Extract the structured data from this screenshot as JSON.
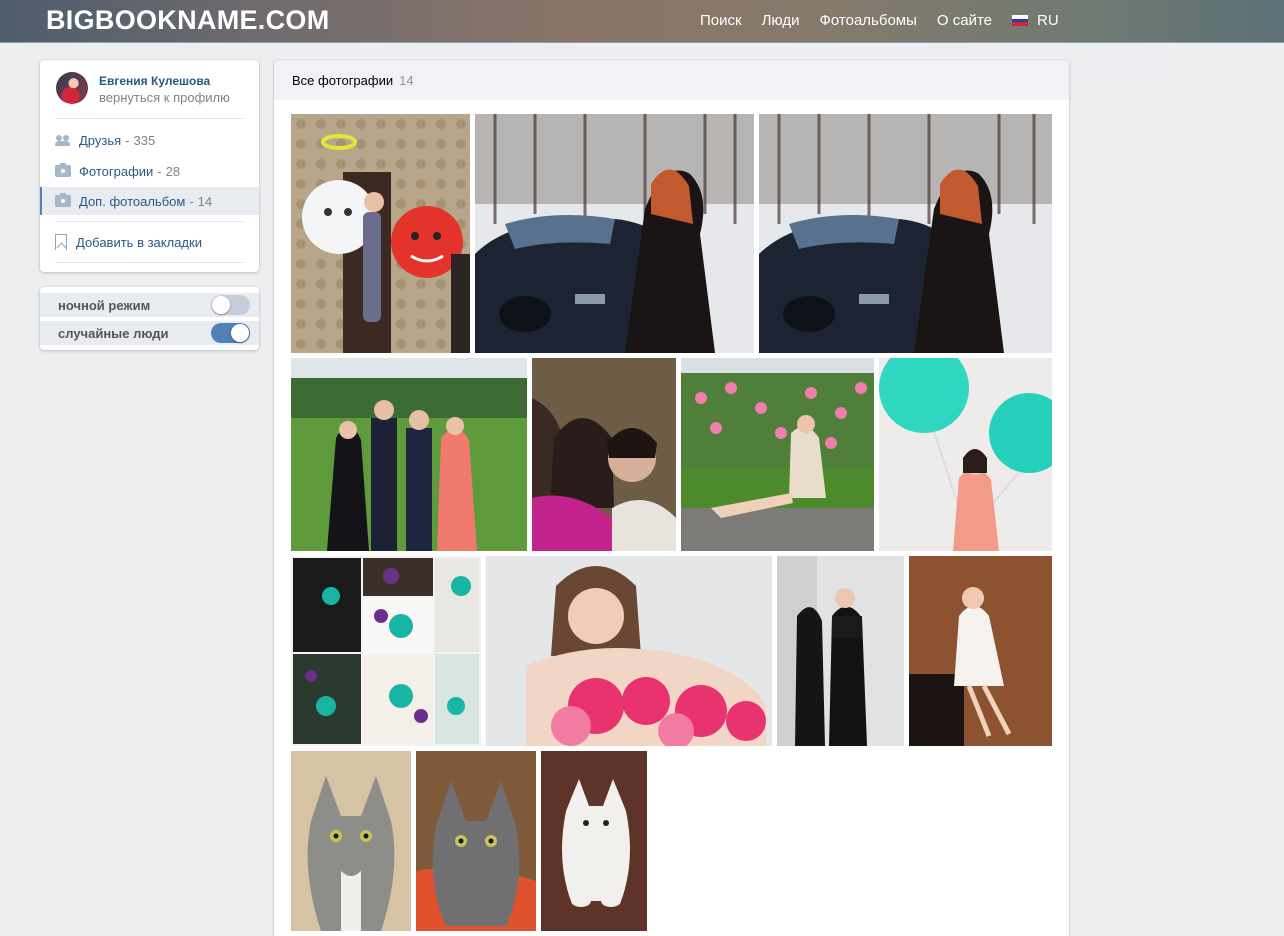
{
  "header": {
    "logo": "BIGBOOKNAME.COM",
    "nav": [
      "Поиск",
      "Люди",
      "Фотоальбомы",
      "О сайте"
    ],
    "lang": "RU"
  },
  "profile": {
    "name": "Евгения Кулешова",
    "back_link": "вернуться к профилю"
  },
  "menu": [
    {
      "label": "Друзья",
      "count": "335"
    },
    {
      "label": "Фотографии",
      "count": "28"
    },
    {
      "label": "Доп. фотоальбом",
      "count": "14"
    }
  ],
  "bookmark": "Добавить в закладки",
  "switches": [
    {
      "label": "ночной режим",
      "on": false
    },
    {
      "label": "случайные люди",
      "on": true
    }
  ],
  "album": {
    "tab_label": "Все фотографии",
    "count": "14"
  },
  "colors": {
    "link": "#2a5885",
    "accent": "#5181b8",
    "page_bg": "#edeef0"
  }
}
